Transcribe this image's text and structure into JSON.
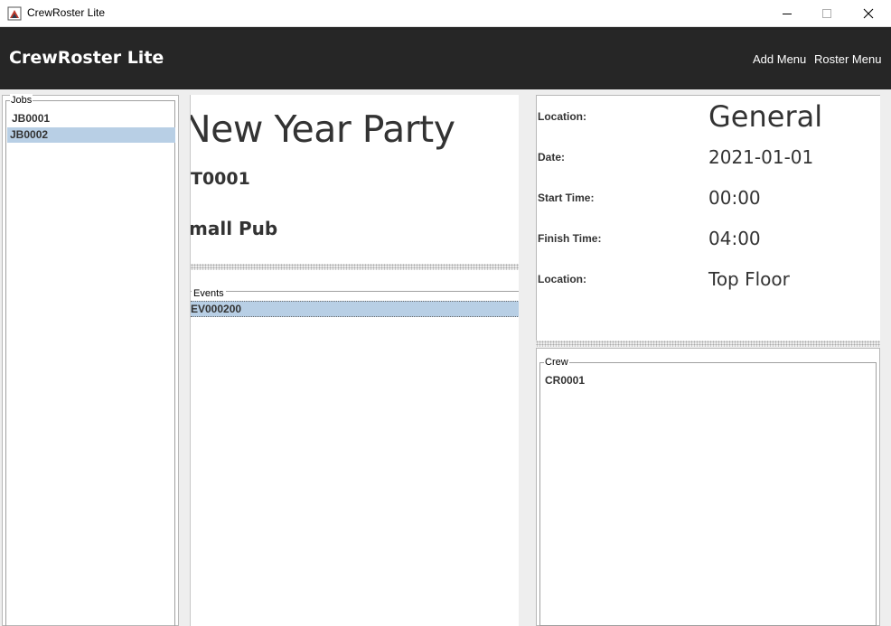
{
  "window": {
    "title": "CrewRoster Lite"
  },
  "header": {
    "app_name": "CrewRoster Lite",
    "menus": [
      "Add Menu",
      "Roster Menu"
    ]
  },
  "jobs": {
    "legend": "Jobs",
    "items": [
      {
        "label": "JB0001",
        "selected": false
      },
      {
        "label": "JB0002",
        "selected": true
      }
    ]
  },
  "event": {
    "title": "New Year Party",
    "code": "T0001",
    "venue": "mall Pub"
  },
  "events": {
    "legend": "Events",
    "items": [
      {
        "label": "EV000200",
        "selected": true
      }
    ]
  },
  "details": [
    {
      "label": "Location:",
      "value": "General"
    },
    {
      "label": "Date:",
      "value": "2021-01-01"
    },
    {
      "label": "Start Time:",
      "value": "00:00"
    },
    {
      "label": "Finish Time:",
      "value": "04:00"
    },
    {
      "label": "Location:",
      "value": "Top Floor"
    }
  ],
  "crew": {
    "legend": "Crew",
    "items": [
      {
        "label": "CR0001"
      }
    ]
  },
  "colors": {
    "header_bg": "#262626",
    "selection": "#b8cfe5",
    "panel_bg": "#eeeeee"
  }
}
